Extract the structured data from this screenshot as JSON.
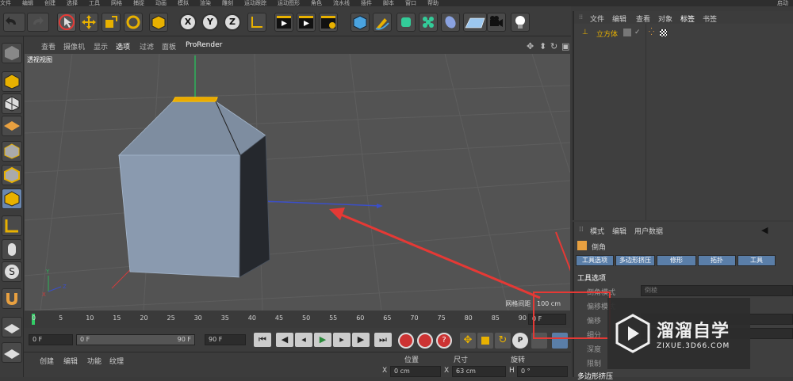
{
  "menubar": [
    "文件",
    "编辑",
    "创建",
    "选择",
    "工具",
    "网格",
    "捕捉",
    "动画",
    "模拟",
    "渲染",
    "雕刻",
    "运动跟踪",
    "运动图形",
    "角色",
    "流水线",
    "插件",
    "脚本",
    "窗口",
    "帮助"
  ],
  "menubar_right": "启动",
  "toolbar": {
    "x": "X",
    "y": "Y",
    "z": "Z"
  },
  "viewport": {
    "menu": [
      "查看",
      "摄像机",
      "显示",
      "选项",
      "过滤",
      "面板",
      "ProRender"
    ],
    "label": "透视视图",
    "grid_info": "网格间距 : 100 cm"
  },
  "timeline": {
    "ticks": [
      "0",
      "5",
      "10",
      "15",
      "20",
      "25",
      "30",
      "35",
      "40",
      "45",
      "50",
      "55",
      "60",
      "65",
      "70",
      "75",
      "80",
      "85",
      "90"
    ],
    "end": "0 F"
  },
  "transport": {
    "start": "0 F",
    "current": "0 F",
    "end_range": "90 F",
    "end": "90 F"
  },
  "bottom_menu": [
    "创建",
    "编辑",
    "功能",
    "纹理"
  ],
  "coords": {
    "headers": [
      "位置",
      "尺寸",
      "旋转"
    ],
    "x_pos": "0 cm",
    "x_size": "63 cm",
    "h_rot": "0 °",
    "x": "X",
    "x2": "X",
    "h": "H"
  },
  "objects": {
    "tabs": [
      "文件",
      "编辑",
      "查看",
      "对象",
      "标签",
      "书签"
    ],
    "items": [
      {
        "name": "立方体"
      }
    ]
  },
  "attributes": {
    "tabs": [
      "模式",
      "编辑",
      "用户数据"
    ],
    "tool_name": "倒角",
    "subtabs": [
      "工具选项",
      "多边形挤压",
      "修形",
      "拓扑",
      "工具"
    ],
    "section": "工具选项",
    "rows": [
      {
        "label": "倒角模式",
        "value": "倒棱"
      },
      {
        "label": "偏移模式",
        "value": ""
      },
      {
        "label": "偏移",
        "value": ""
      },
      {
        "label": "细分",
        "value": ""
      },
      {
        "label": "深度",
        "value": ""
      },
      {
        "label": "限制",
        "value": ""
      }
    ],
    "footer": "多边形挤压"
  },
  "watermark": {
    "title": "溜溜自学",
    "url": "ZIXUE.3D66.COM"
  },
  "colors": {
    "accent": "#e8b100",
    "selection": "#5a7ea8",
    "arrow": "#e53935"
  }
}
